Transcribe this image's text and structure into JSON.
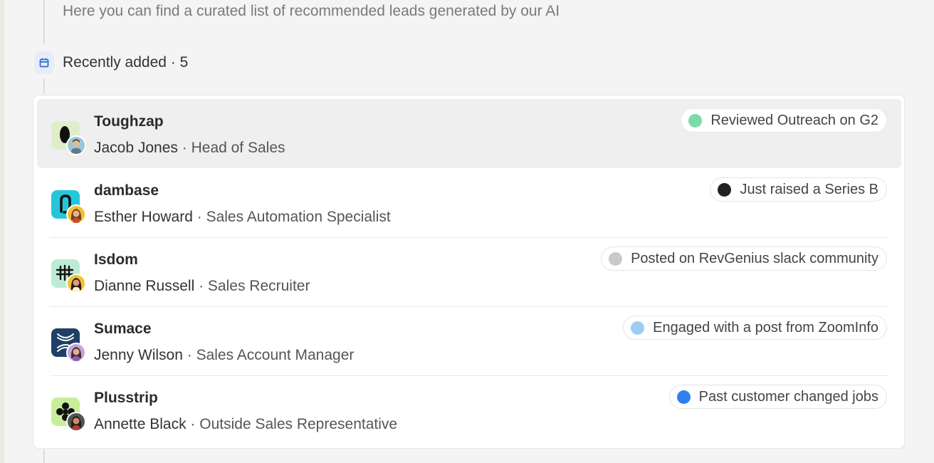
{
  "header": {
    "subtitle": "Here you can find a curated list of recommended leads generated by our AI",
    "section_label": "Recently added · 5",
    "section_icon": "calendar-icon"
  },
  "colors": {
    "accent": "#2f6fd6"
  },
  "leads": [
    {
      "company": "Toughzap",
      "name": "Jacob Jones",
      "role": "Head of Sales",
      "logo_icon": "toughzap-logo",
      "signal": "Reviewed Outreach on G2",
      "signal_color": "#7ed9a8"
    },
    {
      "company": "dambase",
      "name": "Esther Howard",
      "role": "Sales Automation Specialist",
      "logo_icon": "dambase-logo",
      "signal": "Just raised a Series B",
      "signal_color": "#222222"
    },
    {
      "company": "Isdom",
      "name": "Dianne Russell",
      "role": "Sales Recruiter",
      "logo_icon": "isdom-logo",
      "signal": "Posted on RevGenius slack community",
      "signal_color": "#c9c9c9"
    },
    {
      "company": "Sumace",
      "name": "Jenny Wilson",
      "role": "Sales Account Manager",
      "logo_icon": "sumace-logo",
      "signal": "Engaged with a post from ZoomInfo",
      "signal_color": "#9dcdf5"
    },
    {
      "company": "Plusstrip",
      "name": "Annette Black",
      "role": "Outside Sales Representative",
      "logo_icon": "plusstrip-logo",
      "signal": "Past customer changed jobs",
      "signal_color": "#2f80ed"
    }
  ]
}
